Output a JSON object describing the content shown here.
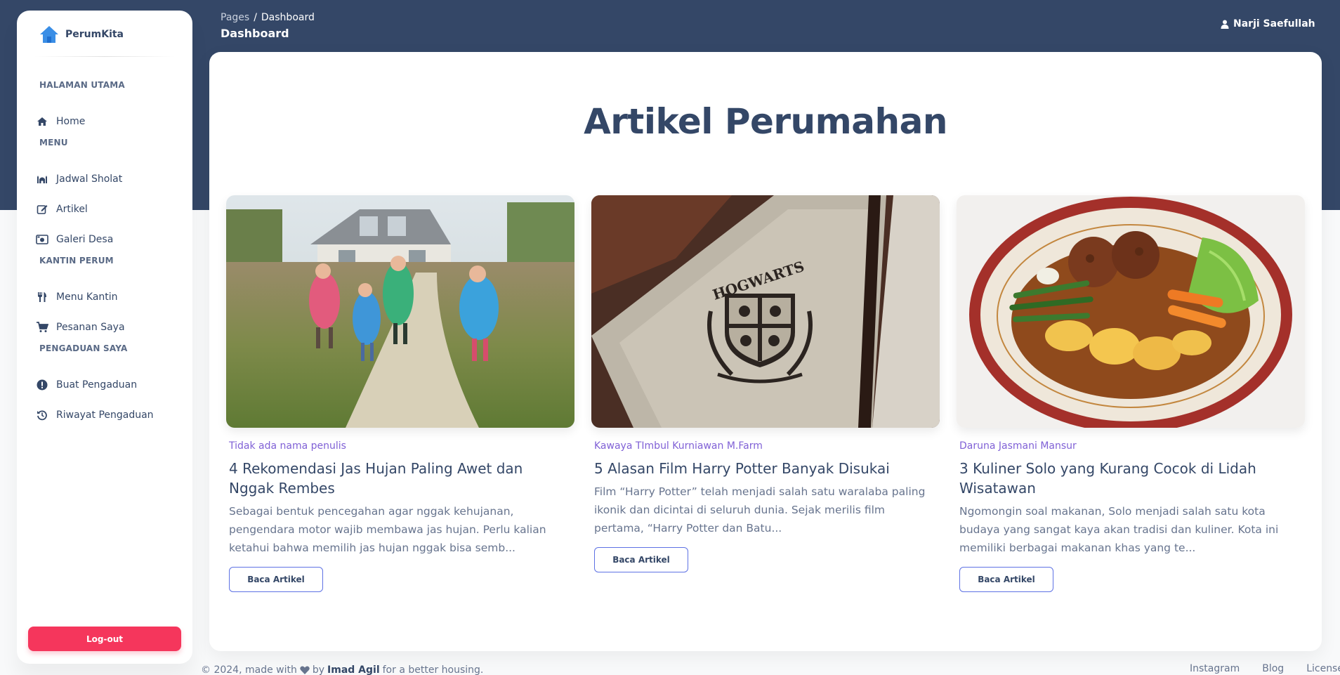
{
  "colors": {
    "header_bg": "#344767",
    "accent": "#5e72e4",
    "danger": "#f5365c",
    "author": "#8061d6"
  },
  "brand": {
    "name": "PerumKita",
    "icon": "house-icon"
  },
  "sidebar": {
    "sections": [
      {
        "title": "HALAMAN UTAMA",
        "items": [
          {
            "label": "Home",
            "icon": "home-icon"
          }
        ]
      },
      {
        "title": "MENU",
        "items": [
          {
            "label": "Jadwal Sholat",
            "icon": "mosque-icon"
          },
          {
            "label": "Artikel",
            "icon": "edit-icon"
          },
          {
            "label": "Galeri Desa",
            "icon": "camera-icon"
          }
        ]
      },
      {
        "title": "KANTIN PERUM",
        "items": [
          {
            "label": "Menu Kantin",
            "icon": "utensils-icon"
          },
          {
            "label": "Pesanan Saya",
            "icon": "cart-icon"
          }
        ]
      },
      {
        "title": "PENGADUAN SAYA",
        "items": [
          {
            "label": "Buat Pengaduan",
            "icon": "exclamation-icon"
          },
          {
            "label": "Riwayat Pengaduan",
            "icon": "history-icon"
          }
        ]
      }
    ],
    "logout_label": "Log-out"
  },
  "header": {
    "breadcrumb": {
      "parent": "Pages",
      "separator": "/",
      "current": "Dashboard"
    },
    "title": "Dashboard",
    "user_name": "Narji Saefullah"
  },
  "main": {
    "heading": "Artikel Perumahan",
    "articles": [
      {
        "author": "Tidak ada nama penulis",
        "title": "4 Rekomendasi Jas Hujan Paling Awet dan Nggak Rembes",
        "excerpt": "Sebagai bentuk pencegahan agar nggak kehujanan, pengendara motor wajib membawa jas hujan. Perlu kalian ketahui bahwa memilih jas hujan nggak bisa semb...",
        "button": "Baca Artikel"
      },
      {
        "author": "Kawaya TImbul Kurniawan M.Farm",
        "title": "5 Alasan Film Harry Potter Banyak Disukai",
        "excerpt": "Film “Harry Potter” telah menjadi salah satu waralaba paling ikonik dan dicintai di seluruh dunia. Sejak merilis film pertama, “Harry Potter dan Batu...",
        "button": "Baca Artikel",
        "image_text": "HOGWARTS"
      },
      {
        "author": "Daruna Jasmani Mansur",
        "title": "3 Kuliner Solo yang Kurang Cocok di Lidah Wisatawan",
        "excerpt": "Ngomongin soal makanan, Solo menjadi salah satu kota budaya yang sangat kaya akan tradisi dan kuliner. Kota ini memiliki berbagai makanan khas yang te...",
        "button": "Baca Artikel"
      }
    ]
  },
  "footer": {
    "copyright": "© 2024, made with",
    "by": "by",
    "author": "Imad Agil",
    "suffix": "for a better housing.",
    "links": [
      "Instagram",
      "Blog",
      "License"
    ]
  }
}
